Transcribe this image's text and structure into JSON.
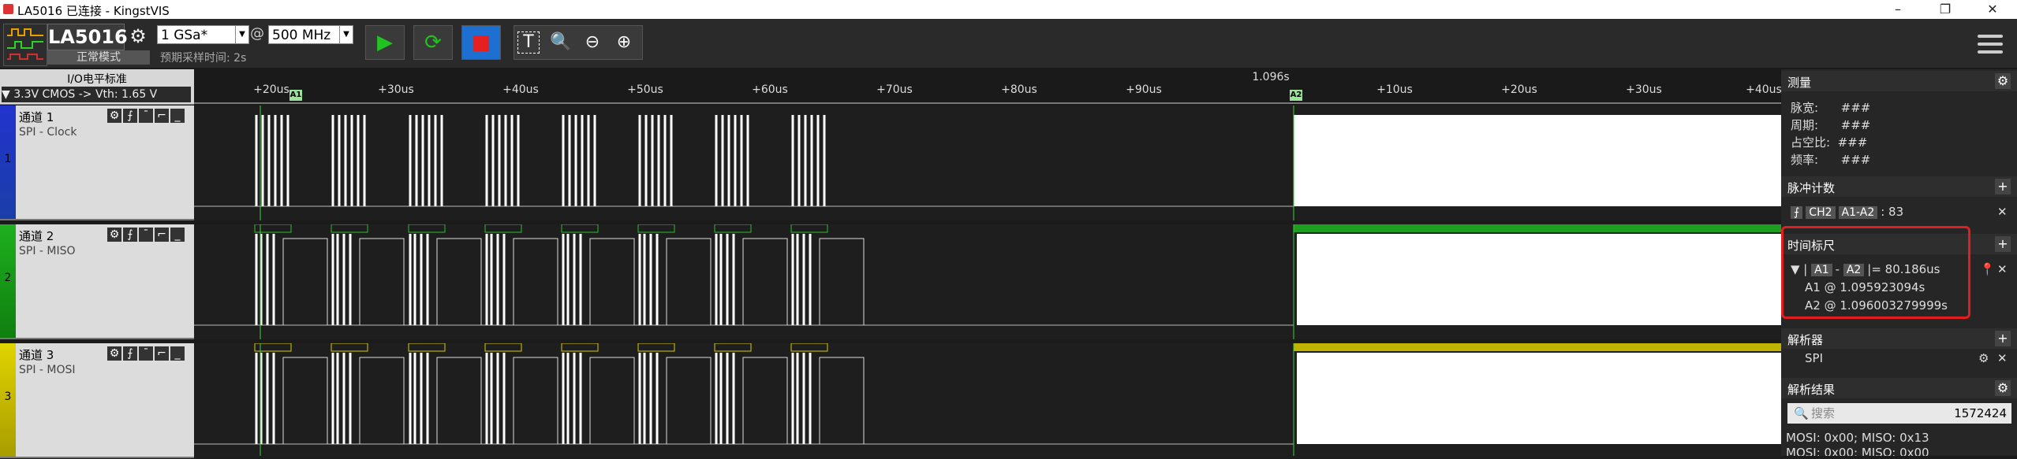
{
  "window": {
    "title": "LA5016 已连接 - KingstVIS",
    "min": "–",
    "max": "❐",
    "close": "✕"
  },
  "device": {
    "name": "LA5016",
    "mode": "正常模式",
    "sample_rate": "1 GSa*",
    "at": "@",
    "threshold_freq": "500 MHz",
    "pre_sample_time": "预期采样时间: 2s"
  },
  "toolbar": {
    "play": "▶",
    "loop": "⟳",
    "stop": "■",
    "text_tool": "T",
    "zoom_fit": "🔍",
    "zoom_out": "⊖",
    "zoom_in": "⊕"
  },
  "io": {
    "title": "I/O电平标准",
    "selected": "▼  3.3V CMOS  -> Vth: 1.65 V"
  },
  "ruler": {
    "top_label": "1.096s",
    "ticks": [
      "+20us",
      "+30us",
      "+40us",
      "+50us",
      "+60us",
      "+70us",
      "+80us",
      "+90us",
      "+10us",
      "+20us",
      "+30us",
      "+40us"
    ],
    "marker_a1": "A1",
    "marker_a2": "A2"
  },
  "channels": [
    {
      "num": "1",
      "name": "通道 1",
      "sub": "SPI - Clock",
      "color": "#2233cc"
    },
    {
      "num": "2",
      "name": "通道 2",
      "sub": "SPI - MISO",
      "color": "#1fb01f"
    },
    {
      "num": "3",
      "name": "通道 3",
      "sub": "SPI - MOSI",
      "color": "#d8cc00"
    }
  ],
  "panel": {
    "measure": {
      "title": "测量",
      "rows": [
        {
          "k": "脉宽:",
          "v": "###"
        },
        {
          "k": "周期:",
          "v": "###"
        },
        {
          "k": "占空比:",
          "v": "###"
        },
        {
          "k": "频率:",
          "v": "###"
        }
      ]
    },
    "pulse": {
      "title": "脉冲计数",
      "edge": "⨍",
      "ch": "CH2",
      "range": "A1-A2",
      "count": ": 83"
    },
    "timing": {
      "title": "时间标尺",
      "expr_a1": "A1",
      "expr_a2": "A2",
      "expr_val": "|= 80.186us",
      "a1_line": "A1 @ 1.095923094s",
      "a2_line": "A2 @ 1.096003279999s"
    },
    "analyzer": {
      "title": "解析器",
      "name": "SPI"
    },
    "results": {
      "title": "解析结果",
      "search_placeholder": "搜索",
      "count": "1572424",
      "row1": "MOSI: 0x00;  MISO: 0x13",
      "row2": "MOSI: 0x00;  MISO: 0x00"
    }
  }
}
